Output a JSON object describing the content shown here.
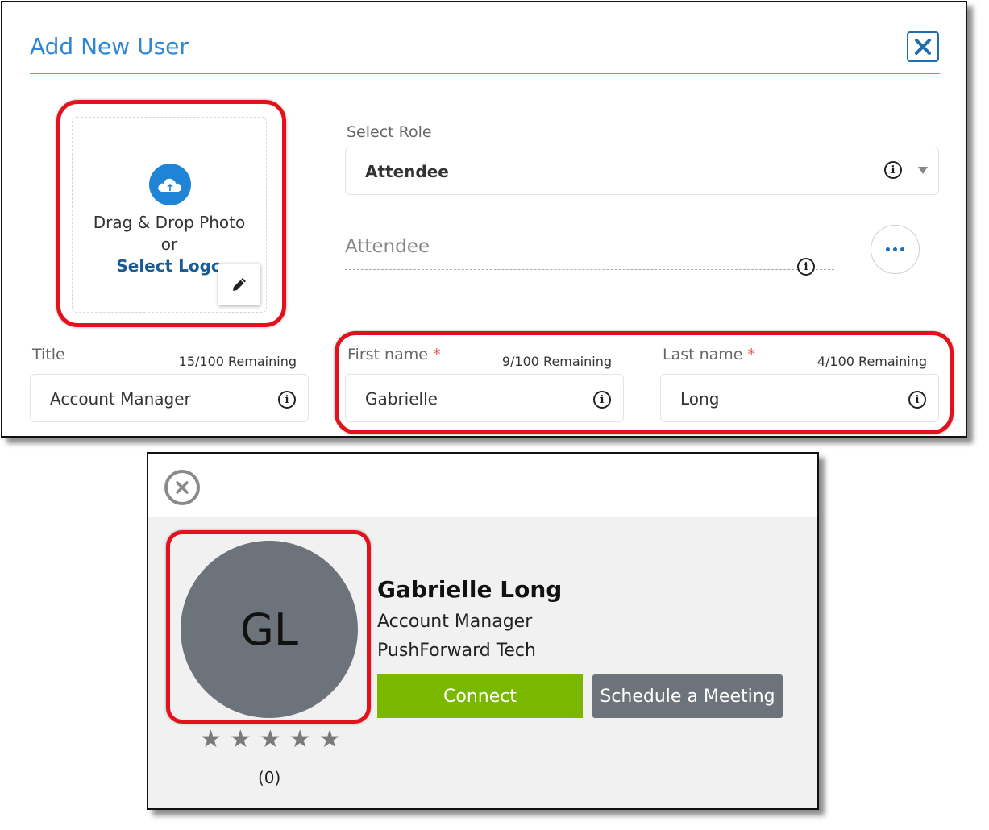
{
  "dialog": {
    "title": "Add New User",
    "photo": {
      "drag_text": "Drag & Drop Photo",
      "or_text": "or",
      "select_text": "Select Logo"
    },
    "role": {
      "label": "Select Role",
      "value": "Attendee"
    },
    "attendee_field": {
      "placeholder": "Attendee"
    },
    "title_field": {
      "label": "Title",
      "remaining": "15/100 Remaining",
      "value": "Account Manager"
    },
    "first_name": {
      "label": "First name",
      "required_mark": "*",
      "remaining": "9/100 Remaining",
      "value": "Gabrielle"
    },
    "last_name": {
      "label": "Last name",
      "required_mark": "*",
      "remaining": "4/100 Remaining",
      "value": "Long"
    },
    "info_glyph": "i"
  },
  "card": {
    "initials": "GL",
    "name": "Gabrielle Long",
    "title": "Account Manager",
    "company": "PushForward Tech",
    "connect_label": "Connect",
    "schedule_label": "Schedule a Meeting",
    "rating": {
      "stars_filled": 0,
      "stars_total": 5,
      "count_text": "(0)"
    }
  },
  "colors": {
    "accent": "#2f86d3",
    "highlight": "#e3111b",
    "connect": "#7ab800",
    "avatar": "#6d737b"
  },
  "icons": [
    "close-icon",
    "cloud-upload-icon",
    "pencil-icon",
    "info-icon",
    "chevron-down-icon",
    "more-icon",
    "close-circle-icon",
    "star-icon"
  ]
}
